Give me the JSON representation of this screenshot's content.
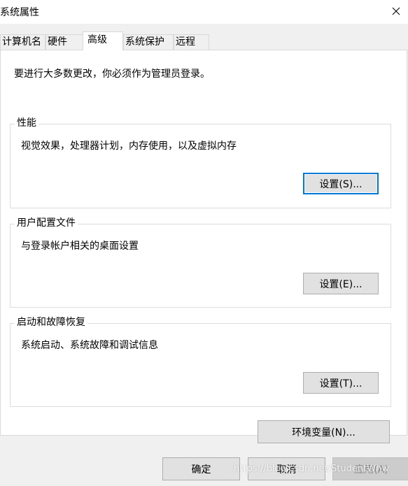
{
  "window": {
    "title": "系统属性",
    "close_icon": "close-icon"
  },
  "tabs": [
    {
      "label": "计算机名",
      "active": false
    },
    {
      "label": "硬件",
      "active": false
    },
    {
      "label": "高级",
      "active": true
    },
    {
      "label": "系统保护",
      "active": false
    },
    {
      "label": "远程",
      "active": false
    }
  ],
  "advanced": {
    "admin_notice": "要进行大多数更改，你必须作为管理员登录。",
    "performance": {
      "title": "性能",
      "description": "视觉效果，处理器计划，内存使用，以及虚拟内存",
      "button": "设置(S)..."
    },
    "user_profiles": {
      "title": "用户配置文件",
      "description": "与登录帐户相关的桌面设置",
      "button": "设置(E)..."
    },
    "startup_recovery": {
      "title": "启动和故障恢复",
      "description": "系统启动、系统故障和调试信息",
      "button": "设置(T)..."
    },
    "env_button": "环境变量(N)..."
  },
  "footer": {
    "ok": "确定",
    "cancel": "取消",
    "apply": "应用(A)"
  },
  "watermark": "https://blog.csdn.net/StudentWhw",
  "colors": {
    "accent": "#0078d7",
    "dialog_bg": "#f0f0f0",
    "panel_bg": "#ffffff",
    "button_bg": "#e1e1e1",
    "disabled_text": "#8c8c8c"
  }
}
